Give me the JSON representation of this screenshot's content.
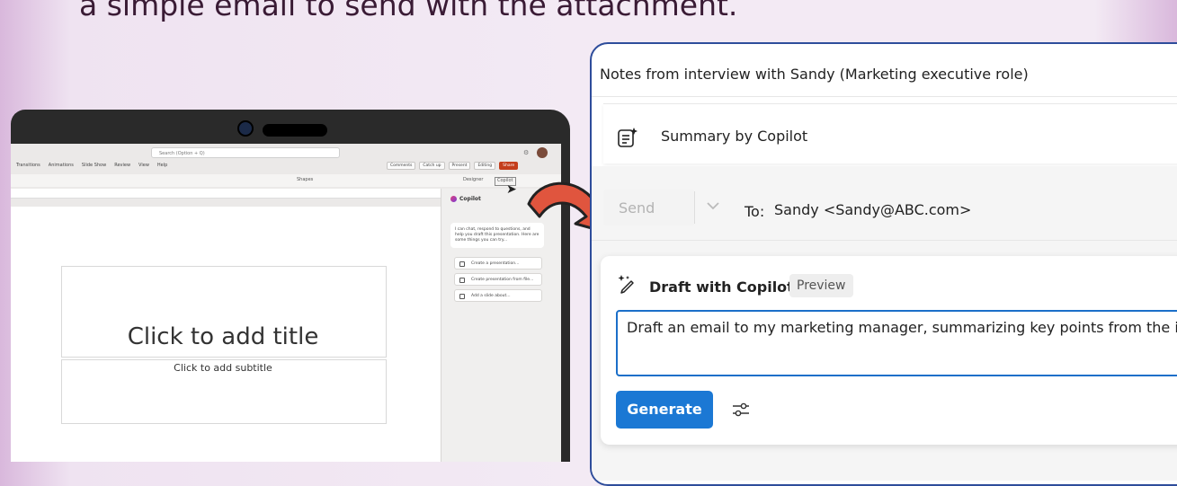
{
  "headline": "a simple email to send with the attachment.",
  "powerpoint": {
    "search_placeholder": "Search (Option + Q)",
    "tabs": [
      "Transitions",
      "Animations",
      "Slide Show",
      "Review",
      "View",
      "Help"
    ],
    "ribbon_right_buttons": [
      "Comments",
      "Catch up",
      "Present",
      "Editing",
      "Share"
    ],
    "toolbar": {
      "shapes_label": "Shapes",
      "designer_label": "Designer",
      "copilot_label": "Copilot"
    },
    "slide": {
      "title_placeholder": "Click to add title",
      "subtitle_placeholder": "Click to add subtitle"
    },
    "copilot_pane": {
      "title": "Copilot",
      "intro": "I can chat, respond to questions, and help you draft this presentation. Here are some things you can try...",
      "options": [
        "Create a presentation...",
        "Create presentation from file...",
        "Add a slide about..."
      ]
    }
  },
  "outlook": {
    "subject": "Notes from interview with Sandy (Marketing executive role)",
    "summary_label": "Summary by Copilot",
    "send_label": "Send",
    "to_label": "To:",
    "to_value": "Sandy <Sandy@ABC.com>",
    "draft_label": "Draft with Copilot",
    "preview_badge": "Preview",
    "prompt_text": "Draft an email to my marketing manager, summarizing key points from the i",
    "generate_label": "Generate"
  },
  "colors": {
    "panel_border": "#2e4d9b",
    "generate_button": "#1b78d4",
    "prompt_border": "#1b6fc9",
    "arrow": "#e0553e",
    "share_button": "#c43e1c"
  }
}
